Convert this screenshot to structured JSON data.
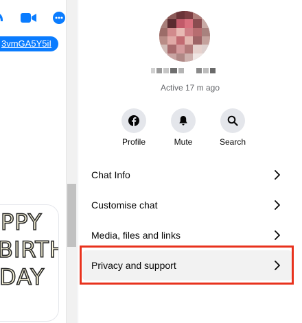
{
  "chat": {
    "link_text": "3vmGA5Y5iI",
    "sticker_lines": [
      "PPY",
      "BIRTH",
      "DAY"
    ]
  },
  "contact": {
    "status": "Active 17 m ago"
  },
  "actions": [
    {
      "label": "Profile",
      "icon": "facebook-icon"
    },
    {
      "label": "Mute",
      "icon": "bell-icon"
    },
    {
      "label": "Search",
      "icon": "search-icon"
    }
  ],
  "menu": [
    {
      "label": "Chat Info"
    },
    {
      "label": "Customise chat"
    },
    {
      "label": "Media, files and links"
    },
    {
      "label": "Privacy and support"
    }
  ],
  "colors": {
    "messenger_blue": "#0a7cff",
    "highlight_red": "#e8321d",
    "button_bg": "#e4e6eb",
    "muted_text": "#65676b"
  }
}
